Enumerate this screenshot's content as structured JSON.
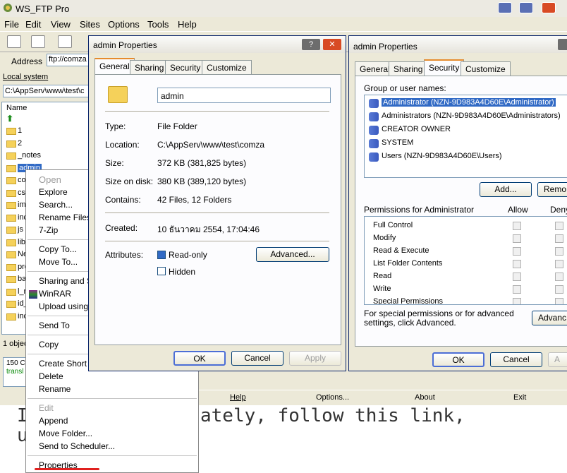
{
  "app": {
    "title": "WS_FTP Pro"
  },
  "menu": [
    "File",
    "Edit",
    "View",
    "Sites",
    "Options",
    "Tools",
    "Help"
  ],
  "address": {
    "label": "Address",
    "value": "ftp://comza"
  },
  "local": {
    "label": "Local system",
    "path": "C:\\AppServ\\www\\test\\c",
    "column": "Name",
    "items": [
      "1",
      "2",
      "_notes",
      "admin",
      "co",
      "cs",
      "im",
      "inc",
      "js",
      "lib",
      "Ne",
      "pro",
      "ba",
      "l_r",
      "id_",
      "inc"
    ],
    "status": "1 objec"
  },
  "log": {
    "line1": "150 C",
    "line2": "transl"
  },
  "bottom_buttons": [
    "Help",
    "Options...",
    "About",
    "Exit"
  ],
  "bg_text": {
    "line1": "ately, follow this link,",
    "line_left": "I",
    "line2": "u"
  },
  "context_menu": {
    "items": [
      "Open",
      "Explore",
      "Search...",
      "Rename Files",
      "7-Zip",
      "Copy To...",
      "Move To...",
      "Sharing and S",
      "WinRAR",
      "Upload using",
      "Send To",
      "Copy",
      "Create Short",
      "Delete",
      "Rename",
      "Edit",
      "Append",
      "Move Folder...",
      "Send to Scheduler...",
      "Properties"
    ]
  },
  "dialog1": {
    "title": "admin Properties",
    "tabs": [
      "General",
      "Sharing",
      "Security",
      "Customize"
    ],
    "name": "admin",
    "fields": [
      {
        "label": "Type:",
        "value": "File Folder"
      },
      {
        "label": "Location:",
        "value": "C:\\AppServ\\www\\test\\comza"
      },
      {
        "label": "Size:",
        "value": "372 KB (381,825 bytes)"
      },
      {
        "label": "Size on disk:",
        "value": "380 KB (389,120 bytes)"
      },
      {
        "label": "Contains:",
        "value": "42 Files, 12 Folders"
      },
      {
        "label": "Created:",
        "value": "10 ธันวาคม 2554, 17:04:46"
      }
    ],
    "attributes_label": "Attributes:",
    "readonly": "Read-only",
    "hidden": "Hidden",
    "advanced": "Advanced...",
    "ok": "OK",
    "cancel": "Cancel",
    "apply": "Apply"
  },
  "dialog2": {
    "title": "admin Properties",
    "tabs": [
      "General",
      "Sharing",
      "Security",
      "Customize"
    ],
    "group_label": "Group or user names:",
    "users": [
      "Administrator (NZN-9D983A4D60E\\Administrator)",
      "Administrators (NZN-9D983A4D60E\\Administrators)",
      "CREATOR OWNER",
      "SYSTEM",
      "Users (NZN-9D983A4D60E\\Users)"
    ],
    "add": "Add...",
    "remove": "Remo",
    "perm_label": "Permissions for Administrator",
    "allow": "Allow",
    "deny": "Deny",
    "perms": [
      "Full Control",
      "Modify",
      "Read & Execute",
      "List Folder Contents",
      "Read",
      "Write",
      "Special Permissions"
    ],
    "special_text": "For special permissions or for advanced settings, click Advanced.",
    "advanced": "Advanc",
    "ok": "OK",
    "cancel": "Cancel",
    "apply": "A"
  },
  "colors": {
    "selection": "#316ac5",
    "underline": "#e0201e",
    "folder": "#f5d15a"
  }
}
